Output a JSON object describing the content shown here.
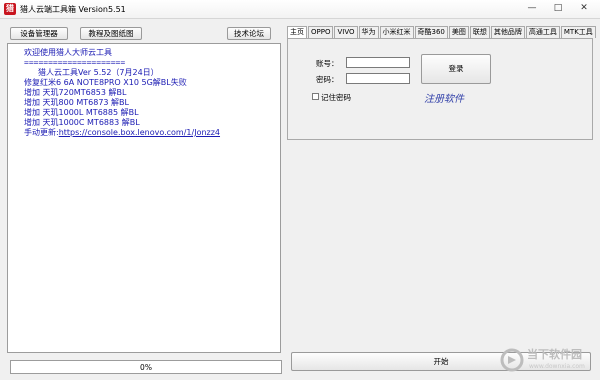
{
  "window": {
    "title": "猎人云端工具箱 Version5.51",
    "icon_text": "猎",
    "controls": [
      "—",
      "□",
      "✕"
    ]
  },
  "toolbar": {
    "device_manager": "设备管理器",
    "tutorial": "教程及图纸图",
    "forum": "技术论坛"
  },
  "log": {
    "lines": [
      "欢迎使用猎人大师云工具",
      "=====================",
      "猎人云工具Ver 5.52（7月24日）",
      "修复红米6 6A NOTE8PRO X10 5G解BL失败",
      "增加 天玑720MT6853 解BL",
      "增加 天玑800 MT6873 解BL",
      "增加 天玑1000L MT6885 解BL",
      "增加 天玑1000C MT6883 解BL"
    ],
    "update_label": "手动更新:",
    "update_link": "https://console.box.lenovo.com/1/Jonzz4"
  },
  "progress": {
    "label": "0%",
    "value": 0
  },
  "tabs": [
    "主页",
    "OPPO",
    "VIVO",
    "华为",
    "小米红米",
    "奇酷360",
    "美图",
    "联想",
    "其他品牌",
    "高通工具",
    "MTK工具"
  ],
  "active_tab": 0,
  "login": {
    "account_label": "账号：",
    "password_label": "密码：",
    "remember_label": "记住密码",
    "login_button": "登录",
    "register_label": "注册软件"
  },
  "start_button": "开始",
  "watermark": {
    "text": "当下软件园",
    "sub": "www.downxia.com"
  },
  "colors": {
    "log_text": "#1b1bb3",
    "register_text": "#2f3ea8",
    "accent_icon": "#c8141e"
  }
}
